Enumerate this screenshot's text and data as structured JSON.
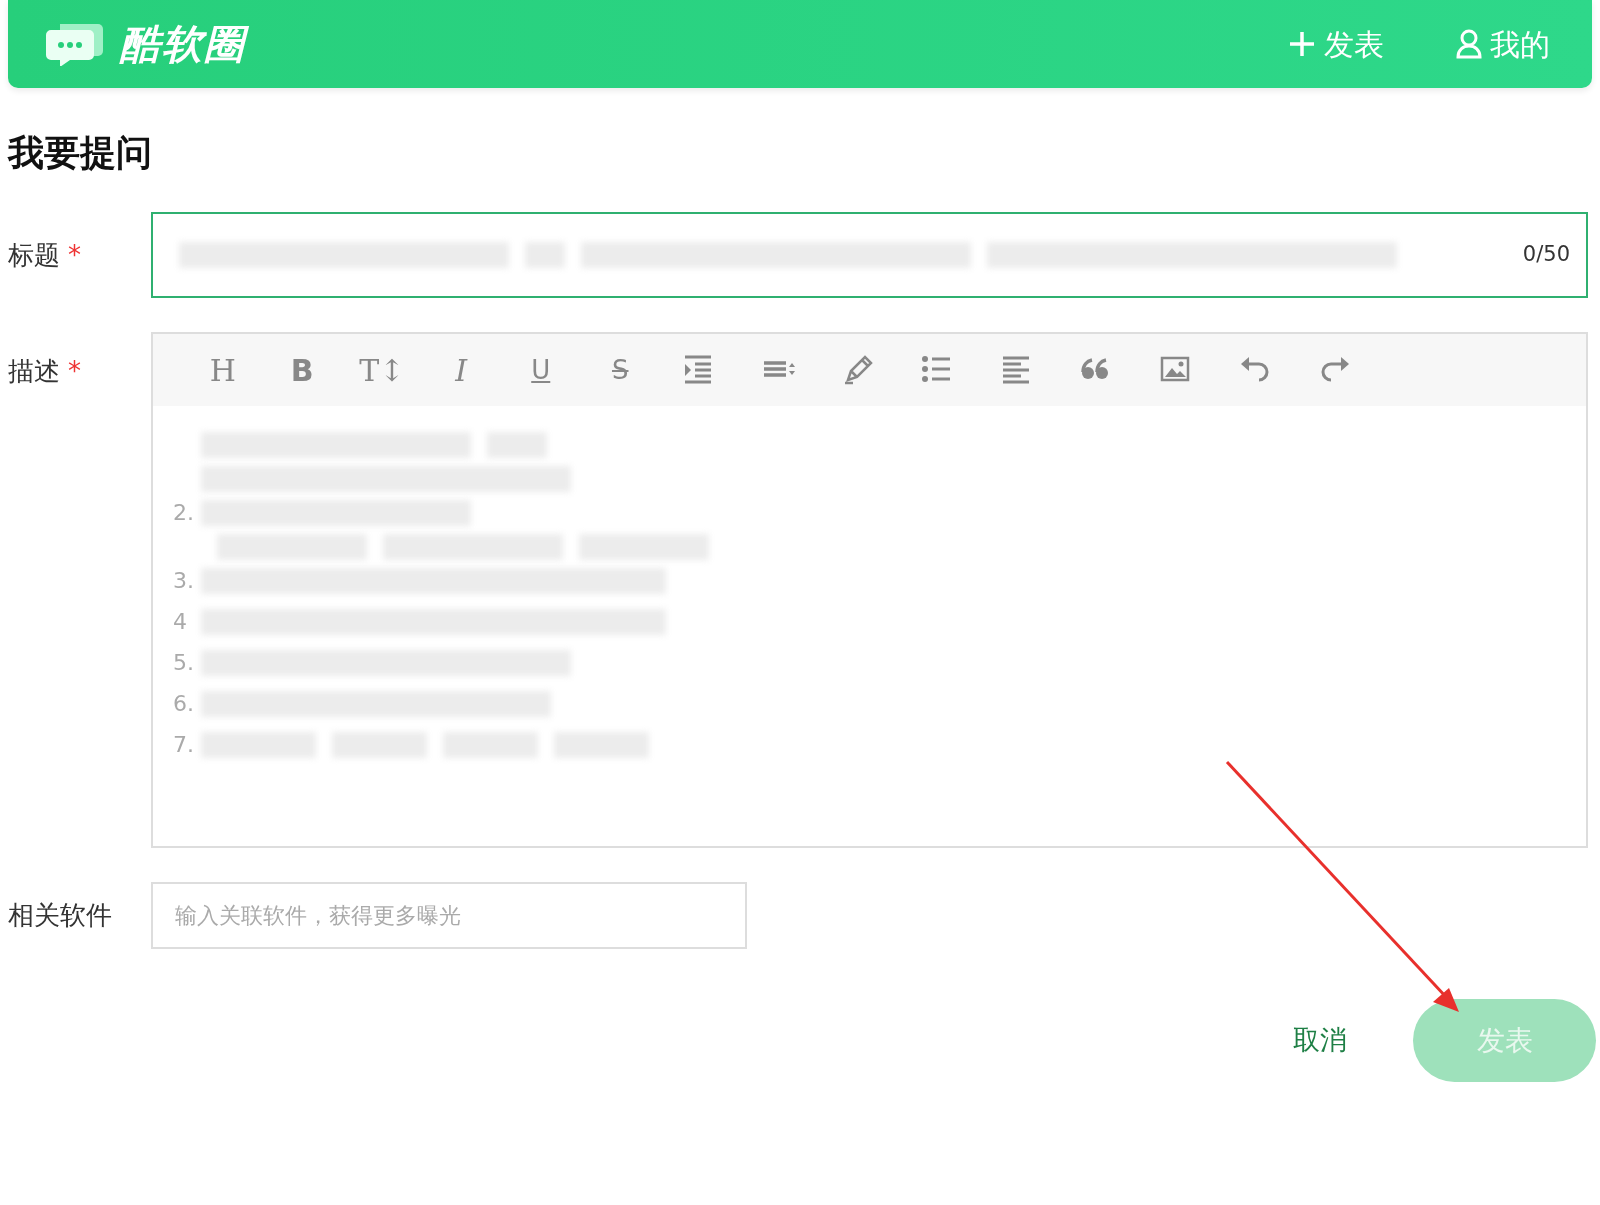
{
  "header": {
    "logo": "酷软圈",
    "actions": [
      {
        "kind": "plus",
        "label": "发表"
      },
      {
        "kind": "user",
        "label": "我的"
      }
    ]
  },
  "page_title": "我要提问",
  "form": {
    "title_field": {
      "label": "标题",
      "required_mark": "*",
      "counter": "0/50"
    },
    "description": {
      "label": "描述",
      "required_mark": "*",
      "toolbar": [
        {
          "kind": "heading",
          "label": "H"
        },
        {
          "kind": "bold",
          "label": "B"
        },
        {
          "kind": "font-size",
          "label": "T↕"
        },
        {
          "kind": "italic",
          "label": "I"
        },
        {
          "kind": "underline",
          "label": "U"
        },
        {
          "kind": "strike",
          "label": "S"
        },
        {
          "kind": "indent"
        },
        {
          "kind": "line-height"
        },
        {
          "kind": "pen"
        },
        {
          "kind": "bullet-list"
        },
        {
          "kind": "align"
        },
        {
          "kind": "quote"
        },
        {
          "kind": "image"
        },
        {
          "kind": "undo"
        },
        {
          "kind": "redo"
        }
      ],
      "list_items": [
        {
          "number": "2."
        },
        {
          "number": "3."
        },
        {
          "number": "4"
        },
        {
          "number": "5."
        },
        {
          "number": "6."
        },
        {
          "number": "7."
        }
      ]
    },
    "software_field": {
      "label": "相关软件",
      "placeholder": "输入关联软件，获得更多曝光"
    }
  },
  "buttons": {
    "cancel": "取消",
    "publish": {
      "label": "发表",
      "disabled": true
    }
  },
  "annotation": {
    "kind": "arrow"
  }
}
